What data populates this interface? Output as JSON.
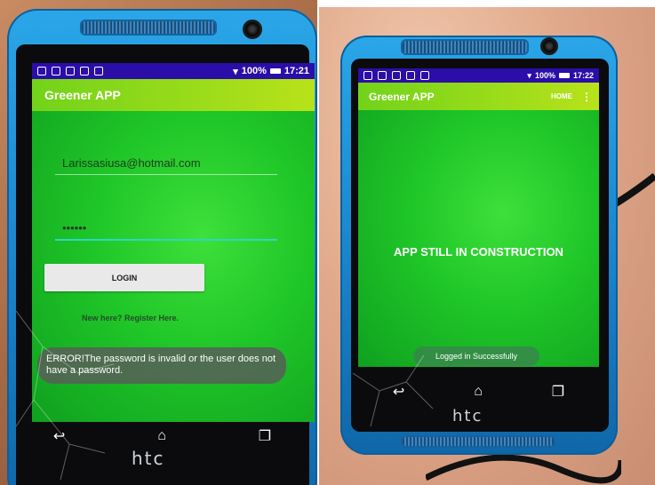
{
  "left_phone": {
    "status_time": "17:21",
    "battery": "100%",
    "app_title": "Greener APP",
    "email_value": "Larissasiusa@hotmail.com",
    "password_value": "••••••",
    "login_label": "LOGIN",
    "register_link": "New here? Register Here.",
    "error_message": "ERROR!The password is invalid or the user does not have a password.",
    "brand": "htc"
  },
  "right_phone": {
    "status_time": "17:22",
    "battery": "100%",
    "app_title": "Greener APP",
    "home_label": "HOME",
    "overflow_label": "⋮",
    "headline": "APP STILL IN CONSTRUCTION",
    "toast": "Logged in Successfully",
    "brand": "htc"
  },
  "colors": {
    "status_bar": "#2b0ea8",
    "app_bar": "#8fd61a",
    "content_green": "#1fc628",
    "phone_blue": "#1780c8"
  },
  "icons": [
    "back-icon",
    "home-icon",
    "recent-apps-icon",
    "wifi-icon",
    "battery-icon"
  ]
}
